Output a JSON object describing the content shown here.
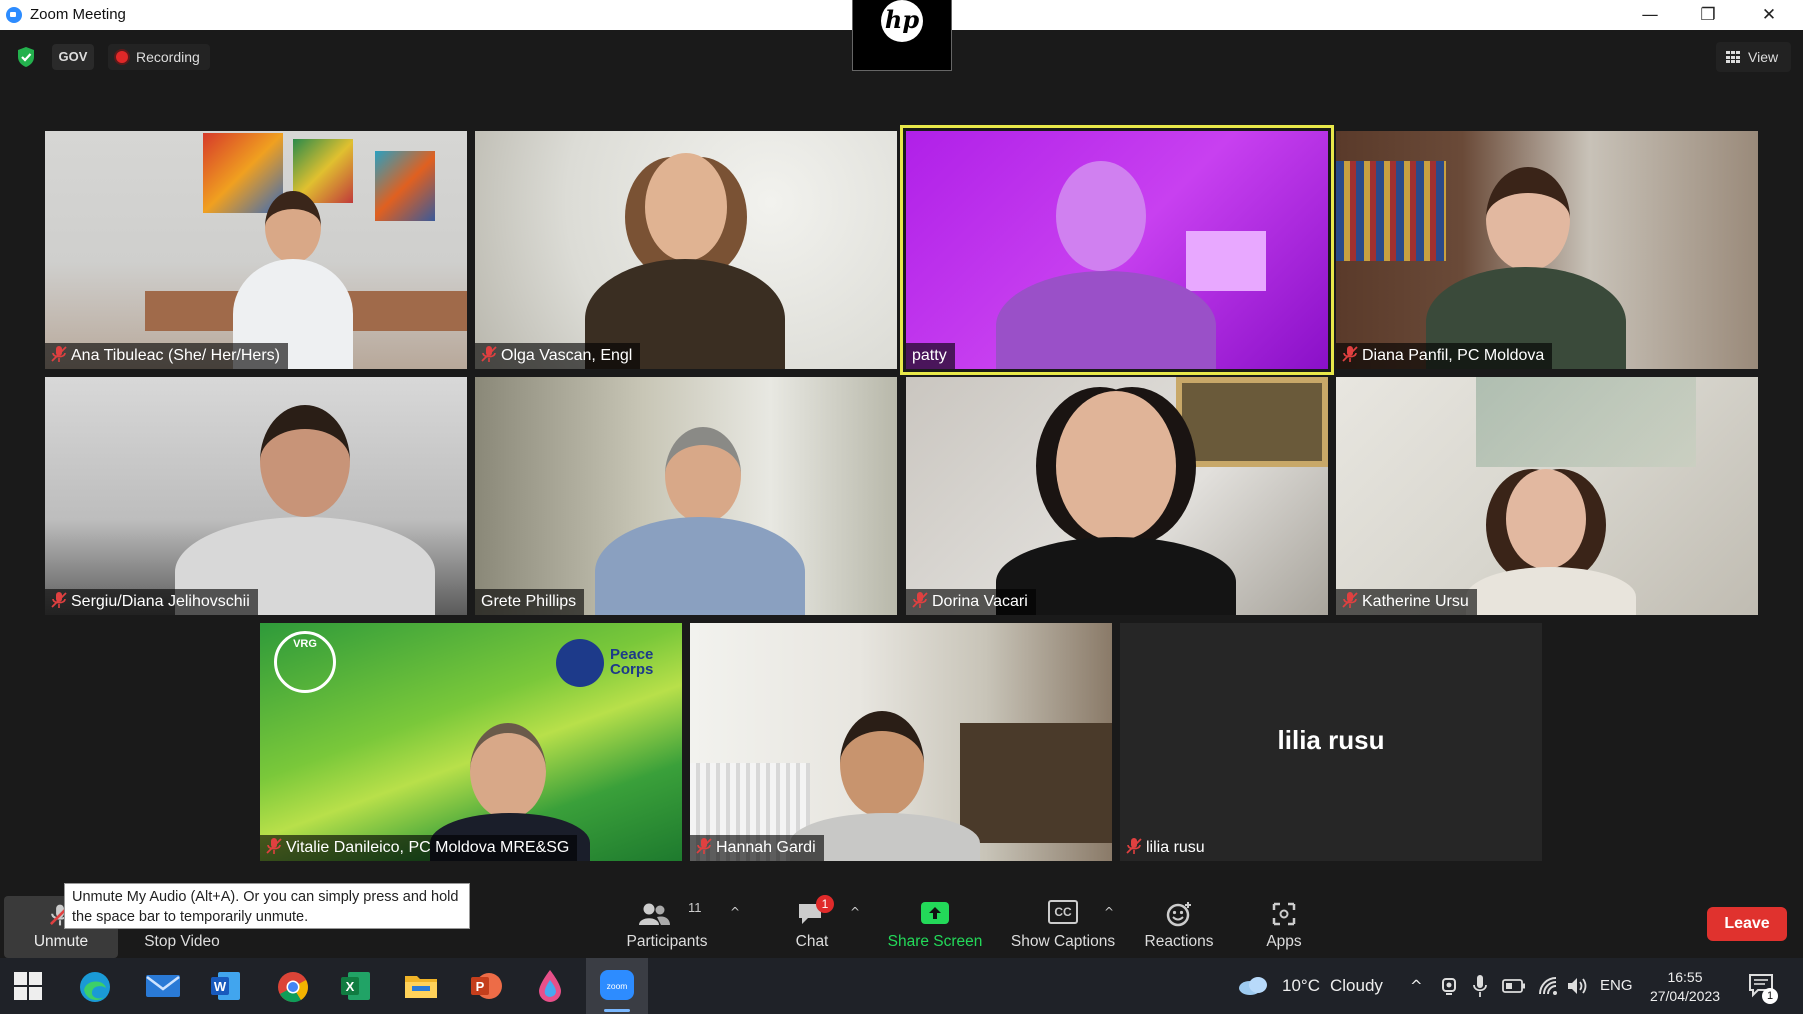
{
  "window": {
    "title": "Zoom Meeting",
    "minimize": "—",
    "restore": "❐",
    "close": "✕"
  },
  "brand_overlay": {
    "logo": "hp"
  },
  "status": {
    "security_icon": "shield-check-icon",
    "gov_badge": "GOV",
    "recording_label": "Recording",
    "view_label": "View"
  },
  "participants": [
    {
      "name": "Ana Tibuleac (She/ Her/Hers)",
      "muted": true
    },
    {
      "name": "Olga Vascan, Engl",
      "muted": true
    },
    {
      "name": "patty",
      "muted": false,
      "active_speaker": true
    },
    {
      "name": "Diana Panfil, PC Moldova",
      "muted": true
    },
    {
      "name": "Sergiu/Diana Jelihovschii",
      "muted": true
    },
    {
      "name": "Grete Phillips",
      "muted": false
    },
    {
      "name": "Dorina Vacari",
      "muted": true
    },
    {
      "name": "Katherine Ursu",
      "muted": true
    },
    {
      "name": "Vitalie Danileico, PC Moldova MRE&SG",
      "muted": true,
      "background_logos": {
        "left": "VRG",
        "right": "Peace\nCorps"
      }
    },
    {
      "name": "Hannah Gardi",
      "muted": true
    },
    {
      "name": "lilia rusu",
      "muted": true,
      "video_off": true,
      "display_name": "lilia rusu"
    }
  ],
  "tooltip": {
    "text": "Unmute My Audio (Alt+A). Or you can simply press and hold the space bar to temporarily unmute."
  },
  "toolbar": {
    "unmute_label": "Unmute",
    "stop_video_label": "Stop Video",
    "participants_label": "Participants",
    "participants_count": "11",
    "chat_label": "Chat",
    "chat_badge": "1",
    "share_screen_label": "Share Screen",
    "show_captions_label": "Show Captions",
    "captions_icon_text": "CC",
    "reactions_label": "Reactions",
    "apps_label": "Apps",
    "leave_label": "Leave",
    "colors": {
      "share": "#23d959",
      "leave": "#e0322e",
      "active_speaker": "#e8e84a"
    }
  },
  "taskbar": {
    "apps": [
      "windows-start-icon",
      "edge-icon",
      "mail-icon",
      "word-icon",
      "chrome-icon",
      "excel-icon",
      "file-explorer-icon",
      "powerpoint-icon",
      "paint-icon",
      "zoom-icon"
    ],
    "weather_temp": "10°C",
    "weather_text": "Cloudy",
    "language": "ENG",
    "time": "16:55",
    "date": "27/04/2023",
    "notifications_count": "1"
  }
}
